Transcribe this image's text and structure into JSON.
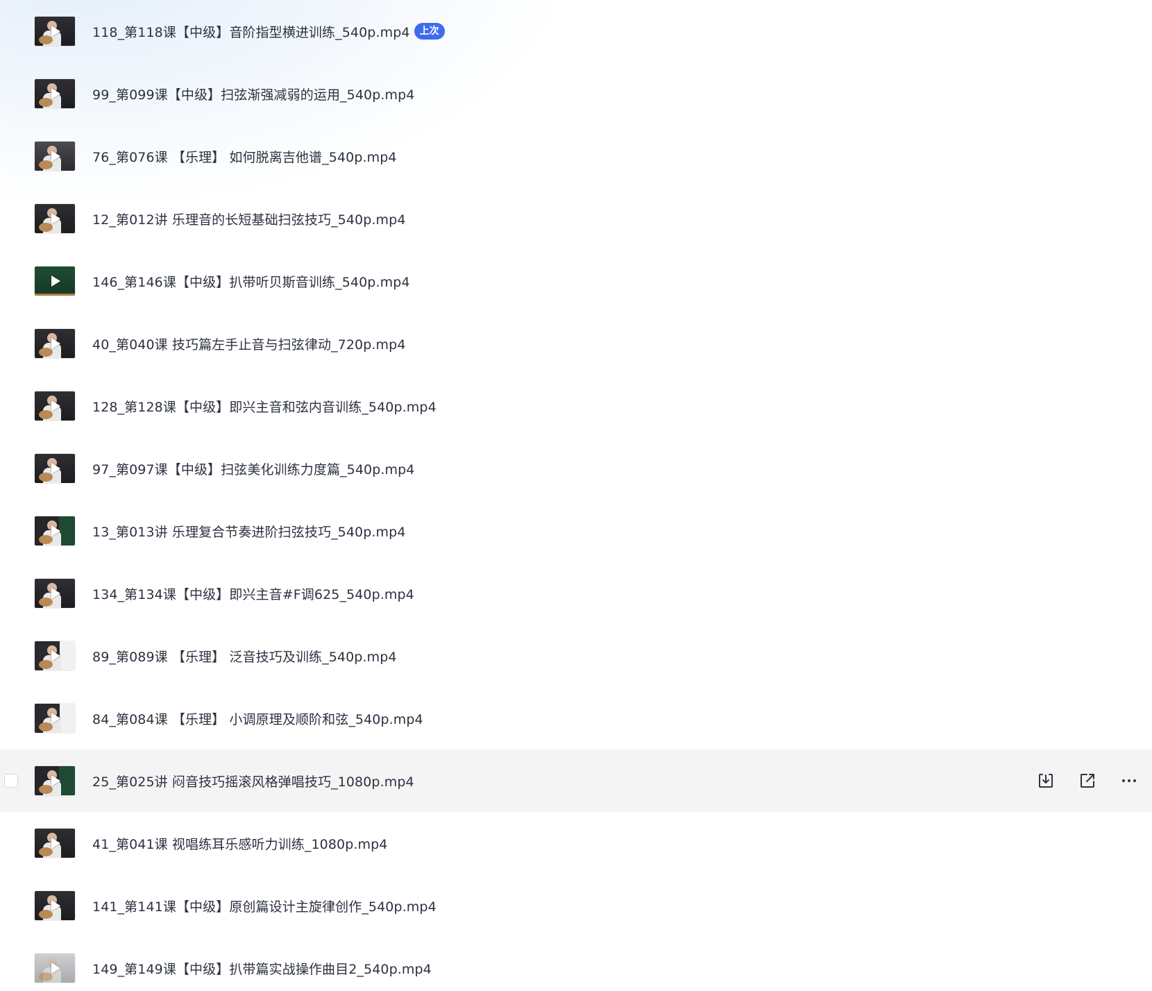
{
  "files": [
    {
      "name": "118_第118课【中级】音阶指型横进训练_540p.mp4",
      "badge": "上次",
      "thumb_style": "dark"
    },
    {
      "name": "99_第099课【中级】扫弦渐强减弱的运用_540p.mp4",
      "thumb_style": "dark"
    },
    {
      "name": "76_第076课 【乐理】 如何脱离吉他谱_540p.mp4",
      "thumb_style": "mid"
    },
    {
      "name": "12_第012讲 乐理音的长短基础扫弦技巧_540p.mp4",
      "thumb_style": "dark"
    },
    {
      "name": "146_第146课【中级】扒带听贝斯音训练_540p.mp4",
      "thumb_style": "green"
    },
    {
      "name": "40_第040课 技巧篇左手止音与扫弦律动_720p.mp4",
      "thumb_style": "dark"
    },
    {
      "name": "128_第128课【中级】即兴主音和弦内音训练_540p.mp4",
      "thumb_style": "dark"
    },
    {
      "name": "97_第097课【中级】扫弦美化训练力度篇_540p.mp4",
      "thumb_style": "dark"
    },
    {
      "name": "13_第013讲 乐理复合节奏进阶扫弦技巧_540p.mp4",
      "thumb_style": "board"
    },
    {
      "name": "134_第134课【中级】即兴主音#F调625_540p.mp4",
      "thumb_style": "dark"
    },
    {
      "name": "89_第089课 【乐理】  泛音技巧及训练_540p.mp4",
      "thumb_style": "sheet"
    },
    {
      "name": "84_第084课 【乐理】 小调原理及顺阶和弦_540p.mp4",
      "thumb_style": "sheet"
    },
    {
      "name": "25_第025讲 闷音技巧摇滚风格弹唱技巧_1080p.mp4",
      "thumb_style": "board",
      "hovered": true
    },
    {
      "name": "41_第041课  视唱练耳乐感听力训练_1080p.mp4",
      "thumb_style": "dark"
    },
    {
      "name": "141_第141课【中级】原创篇设计主旋律创作_540p.mp4",
      "thumb_style": "dark"
    },
    {
      "name": "149_第149课【中级】扒带篇实战操作曲目2_540p.mp4",
      "thumb_style": "light"
    }
  ],
  "row_actions": [
    {
      "name": "download",
      "icon": "download-icon"
    },
    {
      "name": "share",
      "icon": "share-icon"
    },
    {
      "name": "more",
      "icon": "more-icon"
    }
  ],
  "colors": {
    "badge_bg": "#3d6cf0",
    "hover_row_bg": "#f4f4f5",
    "text": "#2c3140",
    "icon": "#30343f"
  }
}
